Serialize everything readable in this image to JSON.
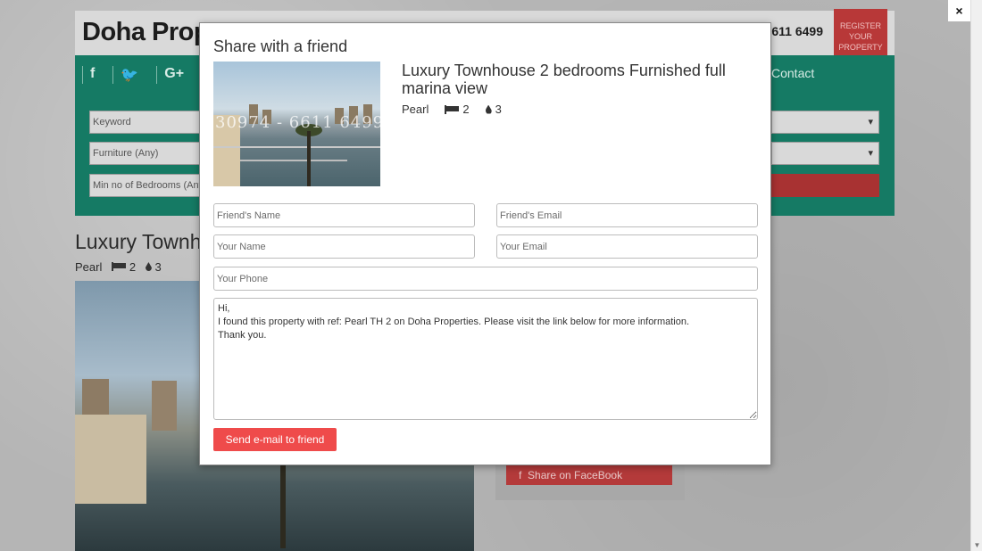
{
  "background": {
    "logo": "Doha Prope",
    "phone": "611 6499",
    "ribbon_text": "REGISTER YOUR PROPERTY",
    "social": [
      "f",
      "🐦",
      "G+"
    ],
    "nav_contact": "Contact",
    "search": {
      "keyword": "Keyword",
      "furniture": "Furniture (Any)",
      "bedrooms": "Min no of Bedrooms (Any"
    },
    "listing_title": "Luxury Townh",
    "listing_meta": {
      "area": "Pearl",
      "beds": "2",
      "baths": "3"
    },
    "share_facebook": "Share on FaceBook"
  },
  "close_button": "×",
  "modal": {
    "title": "Share with a friend",
    "thumbnail_watermark": "30974 - 6611 6499",
    "property_title": "Luxury Townhouse 2 bedrooms Furnished full marina view",
    "area": "Pearl",
    "beds": "2",
    "baths": "3",
    "fields": {
      "friend_name": "Friend's Name",
      "friend_email": "Friend's Email",
      "your_name": "Your Name",
      "your_email": "Your Email",
      "your_phone": "Your Phone"
    },
    "message": "Hi,\nI found this property with ref: Pearl TH 2 on Doha Properties. Please visit the link below for more information.\nThank you.",
    "send_button": "Send e-mail to friend"
  },
  "colors": {
    "accent_green": "#157a64",
    "accent_red": "#ef4b4b",
    "ribbon_red": "#b83838"
  }
}
